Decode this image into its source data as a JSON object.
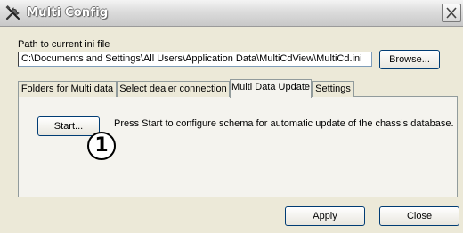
{
  "window": {
    "title": "Multi Config",
    "close_icon": "close-icon",
    "app_icon": "tools-icon"
  },
  "path": {
    "label": "Path to current ini file",
    "value": "C:\\Documents and Settings\\All Users\\Application Data\\MultiCdView\\MultiCd.ini",
    "browse_label": "Browse..."
  },
  "tabs": [
    {
      "label": "Folders for Multi data",
      "active": false
    },
    {
      "label": "Select dealer connection",
      "active": false
    },
    {
      "label": "Multi Data Update",
      "active": true
    },
    {
      "label": "Settings",
      "active": false
    }
  ],
  "panel": {
    "start_label": "Start...",
    "instruction": "Press Start to configure schema for automatic update of the chassis database.",
    "callout": "1"
  },
  "footer": {
    "apply_label": "Apply",
    "close_label": "Close"
  }
}
